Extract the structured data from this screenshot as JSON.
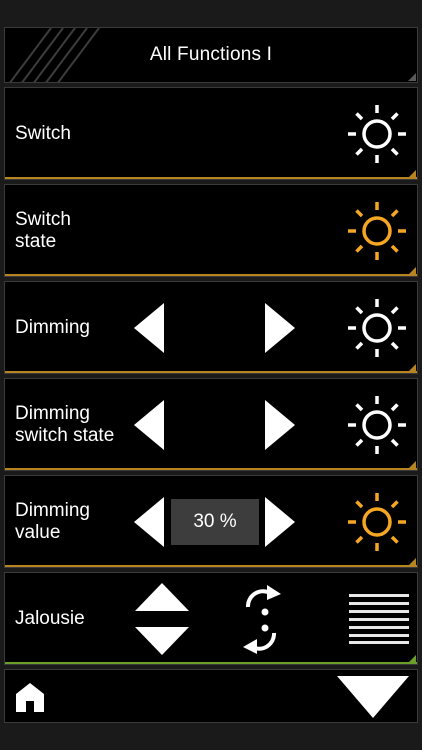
{
  "header": {
    "title": "All Functions I"
  },
  "rows": [
    {
      "label": "Switch",
      "lamp_state": "off",
      "lamp_icon": "light-bulb-icon"
    },
    {
      "label": "Switch\nstate",
      "lamp_state": "on",
      "lamp_icon": "light-bulb-icon"
    },
    {
      "label": "Dimming",
      "lamp_state": "off",
      "lamp_icon": "light-bulb-icon",
      "controls": [
        "dim-down-arrow-icon",
        "dim-up-arrow-icon"
      ]
    },
    {
      "label": "Dimming\nswitch state",
      "lamp_state": "off",
      "lamp_icon": "light-bulb-icon",
      "controls": [
        "dim-down-arrow-icon",
        "dim-up-arrow-icon"
      ]
    },
    {
      "label": "Dimming\nvalue",
      "value": "30 %",
      "lamp_state": "on",
      "lamp_icon": "light-bulb-icon",
      "controls": [
        "dim-down-arrow-icon",
        "dim-up-arrow-icon"
      ]
    },
    {
      "label": "Jalousie",
      "controls": [
        "up-triangle-icon",
        "down-triangle-icon",
        "rotate-slats-icon",
        "blinds-icon"
      ]
    }
  ],
  "footer": {
    "icons": [
      "home-icon",
      "down-arrow-icon"
    ]
  },
  "colors": {
    "background": "#000000",
    "panel_border": "#3a3a3a",
    "lamp_off": "#ffffff",
    "lamp_on": "#f5a623",
    "accent_orange": "#b8841f",
    "accent_green": "#6aa02a",
    "value_box": "#3d3d3d"
  }
}
